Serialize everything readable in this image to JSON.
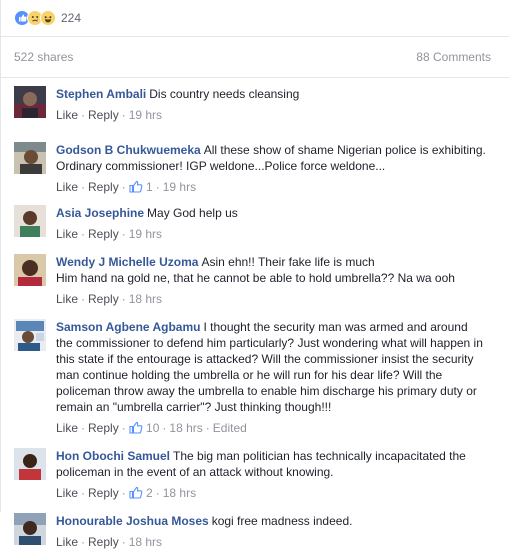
{
  "reactions": {
    "types": [
      "like-icon",
      "sad-icon",
      "haha-icon"
    ],
    "count": "224"
  },
  "stats": {
    "shares": "522 shares",
    "comments": "88 Comments"
  },
  "colors": {
    "author": "#365899",
    "meta": "#90949c",
    "like_blue": "#5890ff"
  },
  "labels": {
    "like": "Like",
    "reply": "Reply",
    "dot": "·"
  },
  "comments": [
    {
      "author": "Stephen Ambali",
      "text": "Dis country needs cleansing",
      "likes": "",
      "time": "19 hrs",
      "edited": ""
    },
    {
      "author": "Godson B Chukwuemeka",
      "text": "All these show of shame Nigerian police is exhibiting. Ordinary commissioner! IGP weldone...Police force weldone...",
      "likes": "1",
      "time": "19 hrs",
      "edited": ""
    },
    {
      "author": "Asia Josephine",
      "text": "May God help us",
      "likes": "",
      "time": "19 hrs",
      "edited": ""
    },
    {
      "author": "Wendy J Michelle Uzoma",
      "text": "Asin ehn!! Their fake life is much\nHim hand na gold ne, that he cannot be able to hold umbrella?? Na wa ooh",
      "likes": "",
      "time": "18 hrs",
      "edited": ""
    },
    {
      "author": "Samson Agbene Agbamu",
      "text": "I thought the security man was armed and around the commissioner to defend him particularly? Just wondering what will happen in this state if the entourage is attacked? Will the commissioner insist the security man continue holding the umbrella or he will run for his dear life? Will the policeman throw away the umbrella to enable him discharge his primary duty or remain an \"umbrella carrier\"? Just thinking though!!!",
      "likes": "10",
      "time": "18 hrs",
      "edited": "Edited"
    },
    {
      "author": "Hon Obochi Samuel",
      "text": "The big man politician has technically incapacitated the policeman in the event of an attack without knowing.",
      "likes": "2",
      "time": "18 hrs",
      "edited": ""
    },
    {
      "author": "Honourable Joshua Moses",
      "text": "kogi free madness indeed.",
      "likes": "",
      "time": "18 hrs",
      "edited": ""
    }
  ]
}
